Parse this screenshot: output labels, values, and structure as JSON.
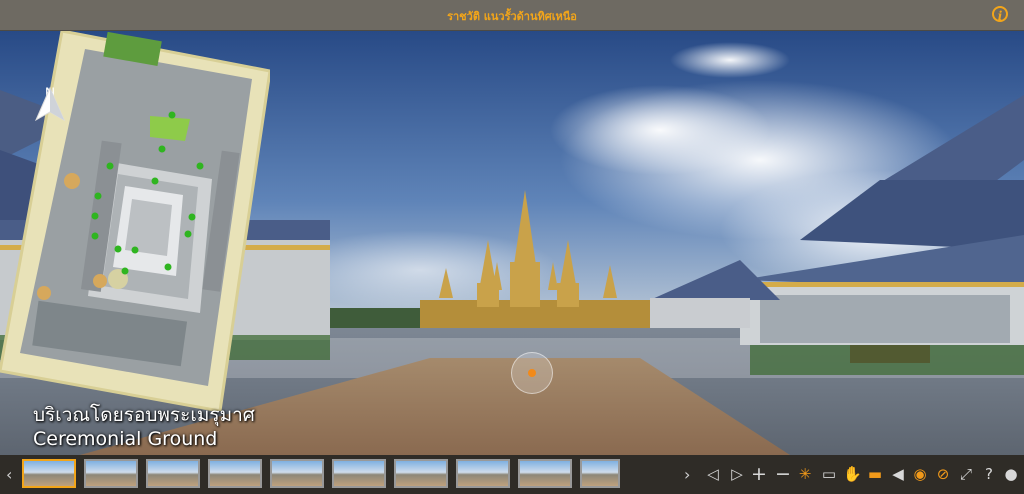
{
  "window": {
    "title": "ราชวัติ แนวรั้วด้านทิศเหนือ"
  },
  "compass": {
    "label": "N"
  },
  "location": {
    "name_th": "บริเวณโดยรอบพระเมรุมาศ",
    "name_en": "Ceremonial Ground"
  },
  "colors": {
    "accent": "#f2a51a",
    "titlebar": "#6e6a62",
    "toolbar": "#2f2c27"
  },
  "thumbnails": {
    "count": 10,
    "active_index": 0
  },
  "toolbar_icons": [
    "chevron-left-icon",
    "chevron-right-icon",
    "rewind-icon",
    "forward-icon",
    "zoom-in-icon",
    "zoom-out-icon",
    "autorotate-icon",
    "vr-icon",
    "hand-drag-icon",
    "map-icon",
    "sound-icon",
    "gyro-icon",
    "hotspots-icon",
    "fullscreen-icon",
    "help-icon",
    "info-icon"
  ]
}
